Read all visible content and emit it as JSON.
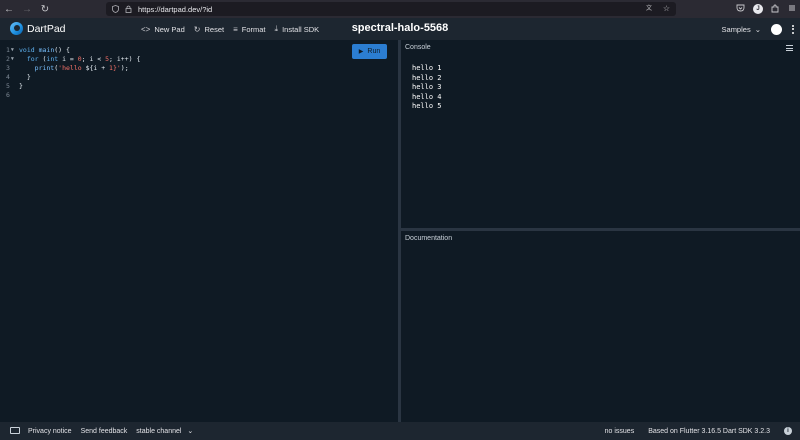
{
  "browser": {
    "url": "https://dartpad.dev/?id",
    "back_icon": "←",
    "forward_icon": "→",
    "reload_icon": "↻",
    "avatar_letter": "J"
  },
  "app": {
    "name": "DartPad",
    "title": "spectral-halo-5568",
    "toolbar": [
      {
        "icon": "<>",
        "label": "New Pad"
      },
      {
        "icon": "↻",
        "label": "Reset"
      },
      {
        "icon": "≡",
        "label": "Format"
      },
      {
        "icon": "⤓",
        "label": "Install SDK"
      }
    ],
    "samples_label": "Samples",
    "samples_chevron": "⌄"
  },
  "editor": {
    "run_label": "Run",
    "line_numbers": [
      "1",
      "2",
      "3",
      "4",
      "5",
      "6"
    ],
    "fold_markers": [
      "▼",
      "▼",
      "",
      "",
      "",
      ""
    ],
    "code": [
      [
        {
          "t": "void ",
          "c": "kw"
        },
        {
          "t": "main",
          "c": "fn"
        },
        {
          "t": "() {",
          "c": ""
        }
      ],
      [
        {
          "t": "  ",
          "c": ""
        },
        {
          "t": "for ",
          "c": "kw"
        },
        {
          "t": "(",
          "c": ""
        },
        {
          "t": "int ",
          "c": "kw"
        },
        {
          "t": "i = ",
          "c": ""
        },
        {
          "t": "0",
          "c": "num"
        },
        {
          "t": "; i < ",
          "c": ""
        },
        {
          "t": "5",
          "c": "num"
        },
        {
          "t": "; i++) {",
          "c": ""
        }
      ],
      [
        {
          "t": "    ",
          "c": ""
        },
        {
          "t": "print",
          "c": "fn"
        },
        {
          "t": "(",
          "c": ""
        },
        {
          "t": "'hello ",
          "c": "str"
        },
        {
          "t": "${i + ",
          "c": ""
        },
        {
          "t": "1",
          "c": "num"
        },
        {
          "t": "}'",
          "c": "str"
        },
        {
          "t": ");",
          "c": ""
        }
      ],
      [
        {
          "t": "  }",
          "c": ""
        }
      ],
      [
        {
          "t": "}",
          "c": ""
        }
      ],
      [
        {
          "t": "",
          "c": ""
        }
      ]
    ]
  },
  "console": {
    "title": "Console",
    "lines": [
      "hello 1",
      "hello 2",
      "hello 3",
      "hello 4",
      "hello 5"
    ]
  },
  "docs": {
    "title": "Documentation"
  },
  "footer": {
    "privacy": "Privacy notice",
    "feedback": "Send feedback",
    "channel": "stable channel",
    "channel_chevron": "⌄",
    "issues": "no issues",
    "sdk_info": "Based on Flutter 3.16.5 Dart SDK 3.2.3",
    "info_glyph": "i"
  }
}
